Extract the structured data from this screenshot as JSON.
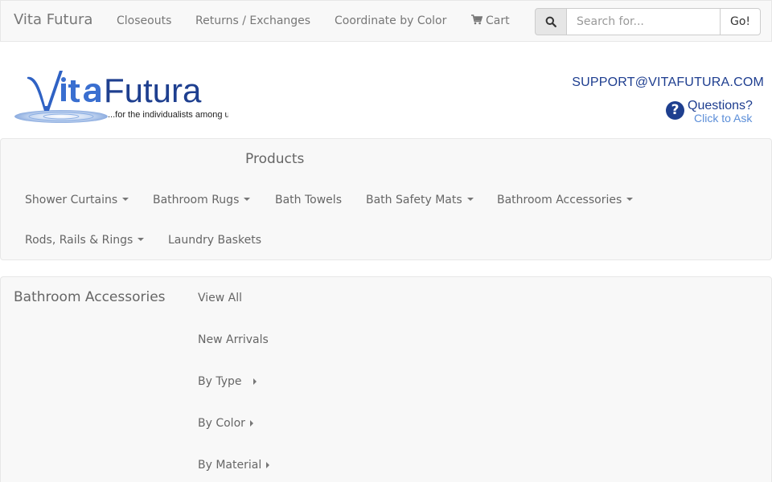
{
  "topnav": {
    "brand": "Vita Futura",
    "items": [
      "Closeouts",
      "Returns / Exchanges",
      "Coordinate by Color"
    ],
    "cart_label": "Cart",
    "search_placeholder": "Search for...",
    "go_label": "Go!"
  },
  "header": {
    "logo_text_vita": "Vita",
    "logo_text_futura": "Futura",
    "logo_tagline": "...for the individualists among us",
    "support_email": "SUPPORT@VITAFUTURA.COM",
    "questions_title": "Questions?",
    "questions_sub": "Click to Ask"
  },
  "products": {
    "title": "Products",
    "items": [
      {
        "label": "Shower Curtains"
      },
      {
        "label": "Bathroom Rugs"
      },
      {
        "label": "Bath Towels"
      },
      {
        "label": "Bath Safety Mats"
      },
      {
        "label": "Bathroom Accessories"
      },
      {
        "label": "Rods, Rails & Rings"
      },
      {
        "label": "Laundry Baskets"
      }
    ]
  },
  "subnav": {
    "title": "Bathroom Accessories",
    "items": [
      {
        "label": "View All"
      },
      {
        "label": "New Arrivals"
      },
      {
        "label": "By Type"
      },
      {
        "label": "By Color"
      },
      {
        "label": "By Material"
      }
    ]
  },
  "colors": {
    "brand_blue": "#1d3d8f",
    "light_blue": "#5b8ed8",
    "panel_bg": "#f8f8f8"
  }
}
